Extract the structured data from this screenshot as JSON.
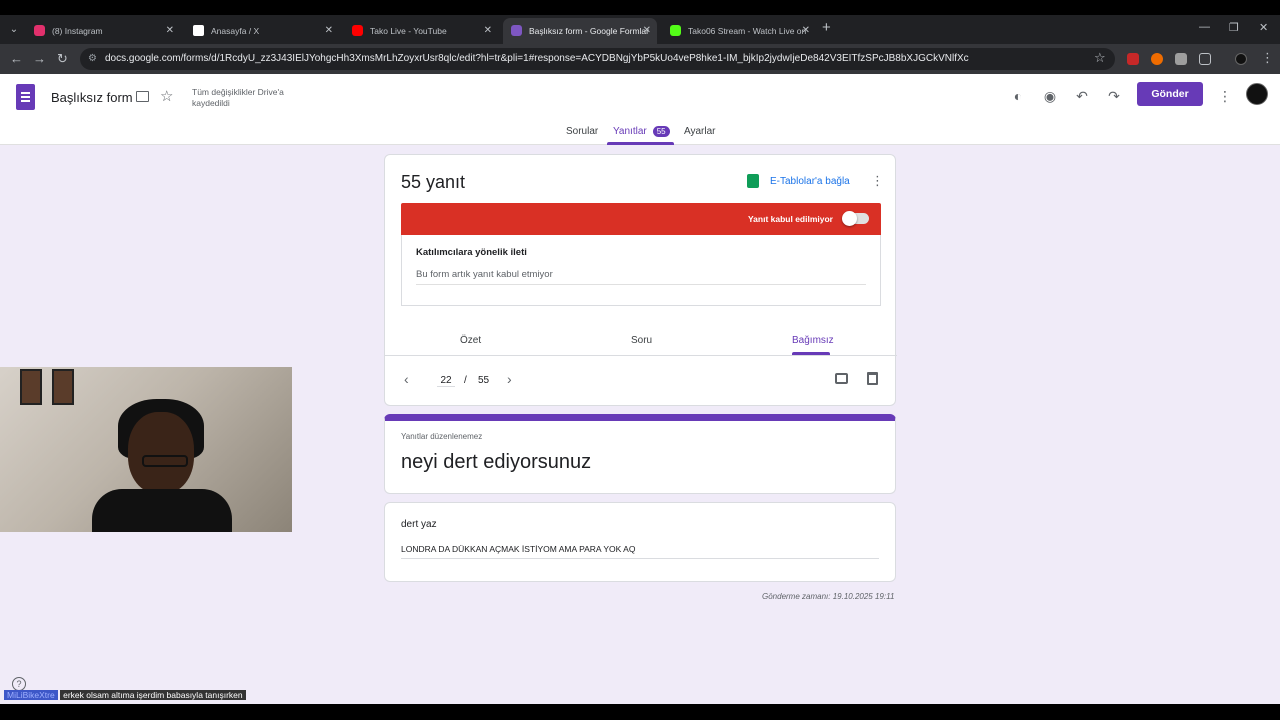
{
  "browser": {
    "tabs": [
      {
        "label": "(8) Instagram",
        "color": "#e1306c"
      },
      {
        "label": "Anasayfa / X",
        "color": "#ffffff"
      },
      {
        "label": "Tako Live - YouTube",
        "color": "#ff0000"
      },
      {
        "label": "Başlıksız form - Google Formlar",
        "color": "#7e57c2"
      },
      {
        "label": "Tako06 Stream - Watch Live on",
        "color": "#53fc18"
      }
    ],
    "url": "docs.google.com/forms/d/1RcdyU_zz3J43IElJYohgcHh3XmsMrLhZoyxrUsr8qlc/edit?hl=tr&pli=1#response=ACYDBNgjYbP5kUo4veP8hke1-IM_bjkIp2jydwIjeDe842V3EITfzSPcJB8bXJGCkVNlfXc"
  },
  "header": {
    "title": "Başlıksız form",
    "save_status": "Tüm değişiklikler Drive'a kaydedildi",
    "send_label": "Gönder"
  },
  "form_tabs": {
    "questions": "Sorular",
    "responses": "Yanıtlar",
    "responses_count": "55",
    "settings": "Ayarlar"
  },
  "responses_card": {
    "title": "55 yanıt",
    "sheets_link": "E-Tablolar'a bağla",
    "accepting_text": "Yanıt kabul edilmiyor",
    "accepting": false,
    "message_label": "Katılımcılara yönelik ileti",
    "message_value": "Bu form artık yanıt kabul etmiyor",
    "view_tabs": [
      "Özet",
      "Soru",
      "Bağımsız"
    ],
    "current_page": "22",
    "separator": "/",
    "total_pages": "55"
  },
  "form_header": {
    "no_edit_note": "Yanıtlar düzenlenemez",
    "title": "neyi dert ediyorsunuz"
  },
  "question": {
    "title": "dert yaz",
    "answer": "LONDRA DA DÜKKAN AÇMAK İSTİYOM AMA PARA YOK AQ"
  },
  "submitted": "Gönderme zamanı: 19.10.2025 19:11",
  "chat": {
    "user": "MiLiBikeXtre",
    "message": "erkek olsam altıma işerdim babasıyla tanışırken"
  },
  "colors": {
    "accent": "#673ab7",
    "closed_banner": "#d93025"
  }
}
